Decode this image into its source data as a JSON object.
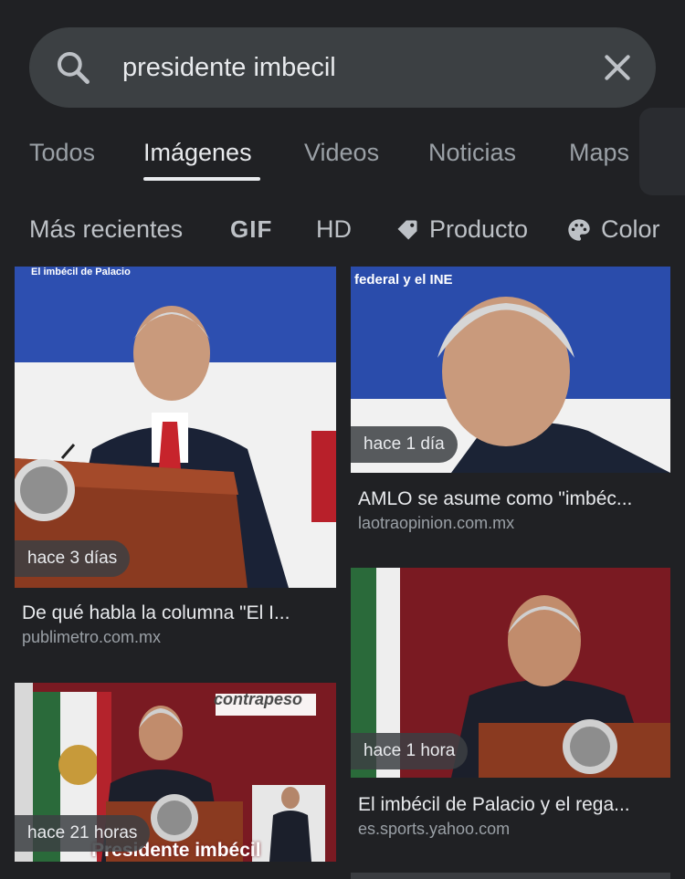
{
  "search": {
    "query": "presidente imbecil"
  },
  "tabs": [
    {
      "label": "Todos"
    },
    {
      "label": "Imágenes"
    },
    {
      "label": "Videos"
    },
    {
      "label": "Noticias"
    },
    {
      "label": "Maps"
    }
  ],
  "chips": {
    "recent": "Más recientes",
    "gif": "GIF",
    "hd": "HD",
    "product": "Producto",
    "color": "Color"
  },
  "results": [
    {
      "age": "hace 3 días",
      "title": "De qué habla la columna \"El I...",
      "source": "publimetro.com.mx",
      "overlay": "El imbécil de Palacio"
    },
    {
      "age": "hace 1 día",
      "title": "AMLO se asume como \"imbéc...",
      "source": "laotraopinion.com.mx",
      "overlay": "federal y el INE"
    },
    {
      "age": "hace 1 hora",
      "title": "El imbécil de Palacio y el rega...",
      "source": "es.sports.yahoo.com"
    },
    {
      "age": "hace 21 horas",
      "title": "",
      "source": "",
      "overlay_brand": "contrapeso",
      "overlay_caption": "Presidente imbécil"
    }
  ],
  "colors": {
    "background": "#202124",
    "search_bg": "#3c4043",
    "text_primary": "#e8eaed",
    "text_secondary": "#9aa0a6"
  }
}
